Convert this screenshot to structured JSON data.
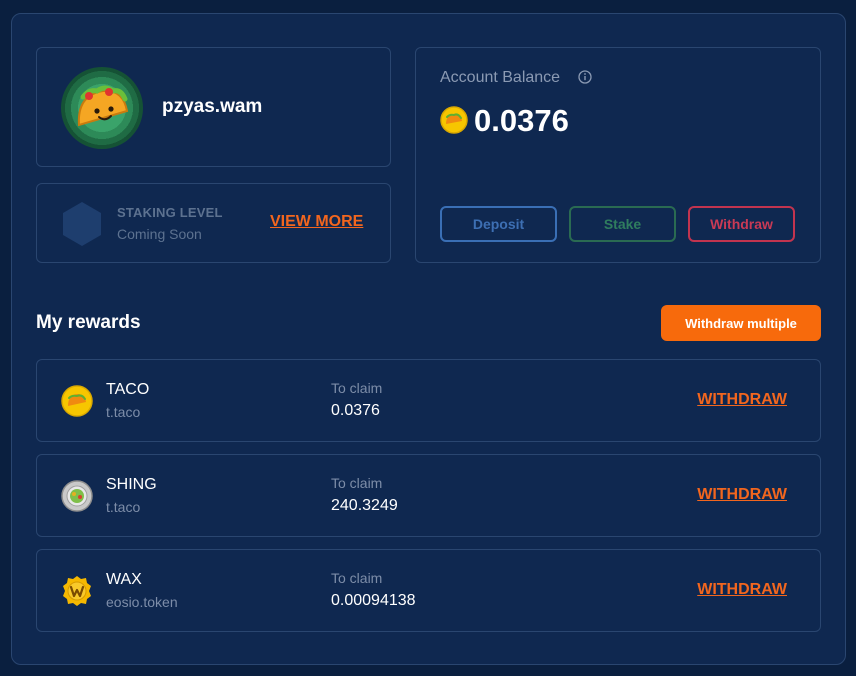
{
  "profile": {
    "username": "pzyas.wam",
    "avatar_icon": "taco-avatar-icon"
  },
  "staking": {
    "label": "STAKING LEVEL",
    "status": "Coming Soon",
    "view_more": "VIEW MORE"
  },
  "balance": {
    "label": "Account Balance",
    "value": "0.0376",
    "deposit": "Deposit",
    "stake": "Stake",
    "withdraw": "Withdraw"
  },
  "rewards": {
    "title": "My rewards",
    "withdraw_multiple": "Withdraw multiple",
    "items": [
      {
        "name": "TACO",
        "contract": "t.taco",
        "claim_label": "To claim",
        "amount": "0.0376",
        "action": "WITHDRAW",
        "icon": "taco-coin-icon"
      },
      {
        "name": "SHING",
        "contract": "t.taco",
        "claim_label": "To claim",
        "amount": "240.3249",
        "action": "WITHDRAW",
        "icon": "shing-coin-icon"
      },
      {
        "name": "WAX",
        "contract": "eosio.token",
        "claim_label": "To claim",
        "amount": "0.00094138",
        "action": "WITHDRAW",
        "icon": "wax-coin-icon"
      }
    ]
  },
  "colors": {
    "background": "#0a1f3f",
    "panel": "#0f2850",
    "accent_orange": "#f76a0c",
    "deposit_blue": "#3a6fb5",
    "stake_green": "#2a6b52",
    "withdraw_red": "#c2344f"
  }
}
